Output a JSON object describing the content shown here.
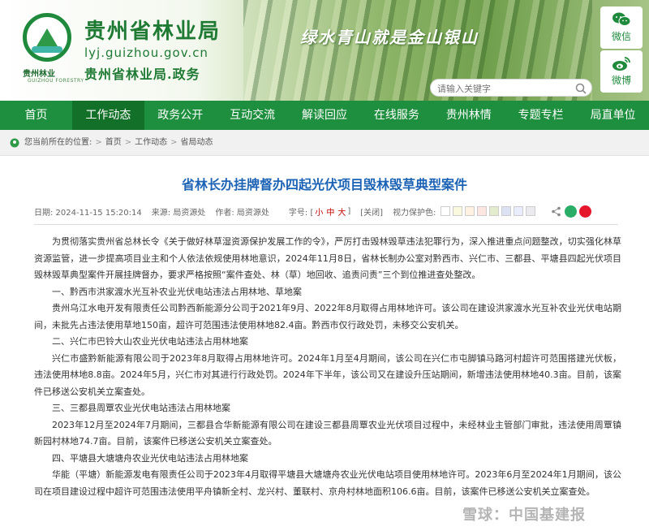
{
  "header": {
    "site_name": "贵州省林业局",
    "domain": "lyj.guizhou.gov.cn",
    "gov_line": "贵州省林业局.政务",
    "logo_caption": "贵州林业",
    "logo_sub": "GUIZHOU FORESTRY",
    "slogan": "绿水青山就是金山银山",
    "search_placeholder": "请输入关键字",
    "social": {
      "wechat": "微信",
      "weibo": "微博"
    }
  },
  "nav": {
    "items": [
      "首页",
      "工作动态",
      "政务公开",
      "互动交流",
      "解读回应",
      "在线服务",
      "贵州林情",
      "专题专栏",
      "局直单位"
    ],
    "active_index": 1
  },
  "breadcrumb": {
    "prefix": "您当前所在的位置:",
    "items": [
      "首页",
      "工作动态",
      "省局动态"
    ]
  },
  "article": {
    "title": "省林长办挂牌督办四起光伏项目毁林毁草典型案件",
    "meta": {
      "date": "日期: 2024-11-15 15:20:14",
      "source": "来源: 局资源处",
      "author": "作者: 局资源处",
      "font_label": "字号: [",
      "font_small": "小",
      "font_medium": "中",
      "font_large": "大",
      "font_close": "]",
      "close": "[关闭]",
      "vision_label": "视力保护色:"
    },
    "paragraphs": [
      "为贯彻落实贵州省总林长令《关于做好林草湿资源保护发展工作的令》，严厉打击毁林毁草违法犯罪行为，深入推进重点问题整改，切实强化林草资源监管，进一步提高项目业主和个人依法依规使用林地意识，2024年11月8日，省林长制办公室对黔西市、兴仁市、三都县、平塘县四起光伏项目毁林毁草典型案件开展挂牌督办，要求严格按照“案件查处、林（草）地回收、追责问责”三个到位推进查处整改。",
      "一、黔西市洪家渡水光互补农业光伏电站违法占用林地、草地案",
      "贵州乌江水电开发有限责任公司黔西新能源分公司于2021年9月、2022年8月取得占用林地许可。该公司在建设洪家渡水光互补农业光伏电站期间，未批先占违法使用草地150亩，超许可范围违法使用林地82.4亩。黔西市仅行政处罚，未移交公安机关。",
      "二、兴仁市巴铃大山农业光伏电站违法占用林地案",
      "兴仁市盛黔新能源有限公司于2023年8月取得占用林地许可。2024年1月至4月期间，该公司在兴仁市屯脚镇马路河村超许可范围搭建光伏板，违法使用林地8.8亩。2024年5月，兴仁市对其进行行政处罚。2024年下半年，该公司又在建设升压站期间，新增违法使用林地40.3亩。目前，该案件已移送公安机关立案查处。",
      "三、三都县周覃农业光伏电站违法占用林地案",
      "2023年12月至2024年7月期间，三都县合华新能源有限公司在建设三都县周覃农业光伏项目过程中，未经林业主管部门审批，违法使用周覃镇新园村林地74.7亩。目前，该案件已移送公安机关立案查处。",
      "四、平塘县大塘塘舟农业光伏电站违法占用林地案",
      "华能（平塘）新能源发电有限责任公司于2023年4月取得平塘县大塘塘舟农业光伏电站项目使用林地许可。2023年6月至2024年1月期间，该公司在项目建设过程中超许可范围违法使用平舟镇新全村、龙兴村、董联村、京舟村林地面积106.6亩。目前，该案件已移送公安机关立案查处。"
    ]
  },
  "colors": {
    "nav_green": "#1e8f3e",
    "nav_active": "#127029",
    "title_blue": "#1d63b5",
    "swatches": [
      "#ffffff",
      "#faf9de",
      "#fff2e2",
      "#fde6e0",
      "#e3edcd",
      "#dce2f1",
      "#e9ebfe",
      "#eaeaef"
    ],
    "share": [
      "#2aae67",
      "#e6162d"
    ]
  },
  "watermark": "雪球：中国基建报"
}
